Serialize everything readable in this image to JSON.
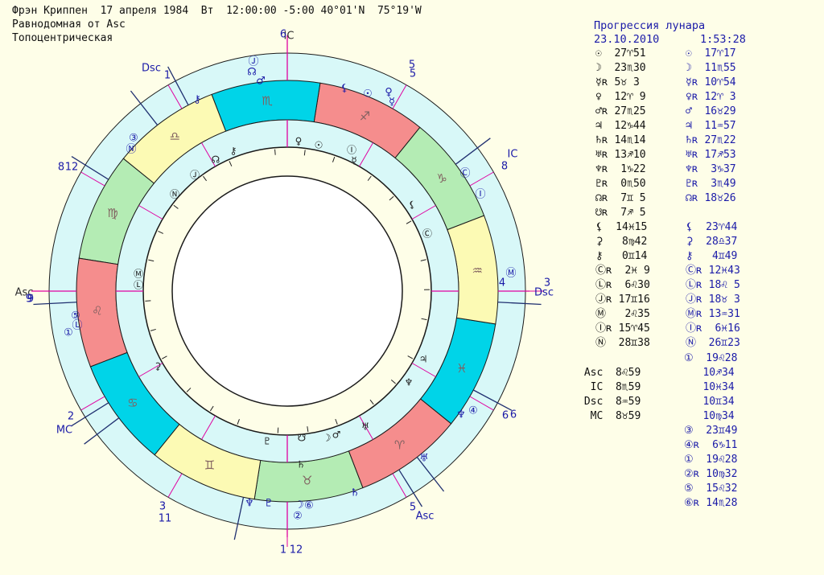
{
  "header": {
    "line1": "Фрэн Криппен  17 апреля 1984  Вт  12:00:00 -5:00 40°01'N  75°19'W",
    "line2": "Равнодомная от Asc",
    "line3": "Топоцентрическая"
  },
  "progression": {
    "title": "Прогрессия лунара",
    "date": "23.10.2010",
    "time": "1:53:28"
  },
  "colors": {
    "background": "#fefee8",
    "outer_ring": "#d8f8f8",
    "fire": "#f58d8d",
    "earth": "#b4ecb4",
    "air": "#fcfab4",
    "water": "#00d4e8",
    "line": "#1a1a1a",
    "axis": "#e000a0",
    "blue": "#1a1aa8"
  },
  "zodiac": [
    {
      "sign": "Taurus",
      "glyph": "♉",
      "element": "earth"
    },
    {
      "sign": "Aries",
      "glyph": "♈",
      "element": "fire"
    },
    {
      "sign": "Pisces",
      "glyph": "♓",
      "element": "water"
    },
    {
      "sign": "Aquarius",
      "glyph": "♒",
      "element": "air"
    },
    {
      "sign": "Capricorn",
      "glyph": "♑",
      "element": "earth"
    },
    {
      "sign": "Sagittarius",
      "glyph": "♐",
      "element": "fire"
    },
    {
      "sign": "Scorpio",
      "glyph": "♏",
      "element": "water"
    },
    {
      "sign": "Libra",
      "glyph": "♎",
      "element": "air"
    },
    {
      "sign": "Virgo",
      "glyph": "♍",
      "element": "earth"
    },
    {
      "sign": "Leo",
      "glyph": "♌",
      "element": "fire"
    },
    {
      "sign": "Cancer",
      "glyph": "♋",
      "element": "water"
    },
    {
      "sign": "Gemini",
      "glyph": "♊",
      "element": "air"
    }
  ],
  "axis_labels": {
    "asc": "Asc",
    "dsc": "Dsc",
    "mc": "MC",
    "ic": "IC",
    "prog_asc": "Asc",
    "prog_dsc": "Dsc",
    "prog_ic": "IC",
    "prog_mc": "MC"
  },
  "house_numbers": {
    "n6": "6",
    "n5": "5",
    "n8": "8",
    "n3": "3",
    "n2": "2",
    "n11": "11",
    "n12": "12",
    "n1": "1",
    "n4": "4",
    "n9": "9",
    "n6b": "6",
    "n12b": "12",
    "nr5": "5",
    "nr1": "1",
    "nr3": "3",
    "nr2": "2",
    "nr4": "4",
    "nr5b": "5",
    "nr6": "6",
    "nr8": "8",
    "nr9": "9"
  },
  "natal_planets": [
    {
      "glyph": "☉",
      "value": "27♈51"
    },
    {
      "glyph": "☽",
      "value": "23♏30"
    },
    {
      "glyph": "☿ʀ",
      "value": "5♉ 3"
    },
    {
      "glyph": "♀",
      "value": "12♈ 9"
    },
    {
      "glyph": "♂ʀ",
      "value": "27♏25"
    },
    {
      "glyph": "♃",
      "value": "12♑44"
    },
    {
      "glyph": "♄ʀ",
      "value": "14♏14"
    },
    {
      "glyph": "♅ʀ",
      "value": "13♐10"
    },
    {
      "glyph": "♆ʀ",
      "value": " 1♑22"
    },
    {
      "glyph": "♇ʀ",
      "value": " 0♏50"
    },
    {
      "glyph": "☊ʀ",
      "value": " 7♊ 5"
    },
    {
      "glyph": "☋ʀ",
      "value": " 7♐ 5"
    },
    {
      "glyph": "⚸",
      "value": "14♓15"
    },
    {
      "glyph": "⚳",
      "value": " 8♍42"
    },
    {
      "glyph": "⚷",
      "value": " 0♊14"
    },
    {
      "glyph": "Ⓒʀ",
      "value": " 2♓ 9"
    },
    {
      "glyph": "Ⓛʀ",
      "value": " 6♌30"
    },
    {
      "glyph": "Ⓙʀ",
      "value": "17♊16"
    },
    {
      "glyph": "Ⓜ",
      "value": " 2♌35"
    },
    {
      "glyph": "Ⓘʀ",
      "value": "15♈45"
    },
    {
      "glyph": "Ⓝ",
      "value": "28♊38"
    }
  ],
  "prog_planets": [
    {
      "glyph": "☉",
      "value": "17♈17"
    },
    {
      "glyph": "☽",
      "value": "11♏55"
    },
    {
      "glyph": "☿ʀ",
      "value": "10♈54"
    },
    {
      "glyph": "♀ʀ",
      "value": "12♈ 3"
    },
    {
      "glyph": "♂",
      "value": "16♉29"
    },
    {
      "glyph": "♃",
      "value": "11♒57"
    },
    {
      "glyph": "♄ʀ",
      "value": "27♏22"
    },
    {
      "glyph": "♅ʀ",
      "value": "17♐53"
    },
    {
      "glyph": "♆ʀ",
      "value": " 3♑37"
    },
    {
      "glyph": "♇ʀ",
      "value": " 3♏49"
    },
    {
      "glyph": "☊ʀ",
      "value": "18♉26"
    },
    {
      "glyph": "",
      "value": ""
    },
    {
      "glyph": "⚸",
      "value": "23♈44"
    },
    {
      "glyph": "⚳",
      "value": "28♎37"
    },
    {
      "glyph": "⚷",
      "value": " 4♊49"
    },
    {
      "glyph": "Ⓒʀ",
      "value": "12♓43"
    },
    {
      "glyph": "Ⓛʀ",
      "value": "18♌ 5"
    },
    {
      "glyph": "Ⓙʀ",
      "value": "18♉ 3"
    },
    {
      "glyph": "Ⓜʀ",
      "value": "13♒31"
    },
    {
      "glyph": "Ⓘʀ",
      "value": " 6♓16"
    },
    {
      "glyph": "Ⓝ",
      "value": "26♊23"
    }
  ],
  "angles_natal": [
    {
      "name": "Asc",
      "value": "8♌59"
    },
    {
      "name": "IC",
      "value": "8♏59"
    },
    {
      "name": "Dsc",
      "value": "8♒59"
    },
    {
      "name": "MC",
      "value": "8♉59"
    }
  ],
  "prog_extra": [
    "①  19♌28",
    "   10♐34",
    "   10♓34",
    "   10♊34",
    "   10♍34",
    "③  23♊49",
    "④ʀ  6♑11",
    "①  19♌28",
    "②ʀ 10♍32",
    "⑤  15♌32",
    "⑥ʀ 14♏28"
  ],
  "wheel_glyphs": {
    "outer_top": [
      "Ⓙ",
      "☊",
      "♂",
      "⚷",
      "⚸",
      "☉",
      "♀",
      "☿"
    ],
    "outer_left": [
      "③",
      "Ⓝ",
      "⑤",
      "Ⓛ",
      "①"
    ],
    "outer_right": [
      "Ⓒ",
      "Ⓘ",
      "Ⓜ",
      "④",
      "♆",
      "♅"
    ],
    "outer_bottom": [
      "♆",
      "♇",
      "☽",
      "②",
      "⑥",
      "♄"
    ],
    "inner_top": [
      "♀",
      "☉",
      "Ⓘ",
      "☿",
      "☊",
      "⚷",
      "Ⓙ",
      "Ⓝ",
      "⚸",
      "Ⓒ"
    ],
    "inner_left": [
      "Ⓜ",
      "Ⓛ",
      "⚳"
    ],
    "inner_bottom": [
      "♃",
      "♆",
      "♅",
      "☋",
      "☽",
      "♂",
      "♄",
      "♇"
    ]
  }
}
